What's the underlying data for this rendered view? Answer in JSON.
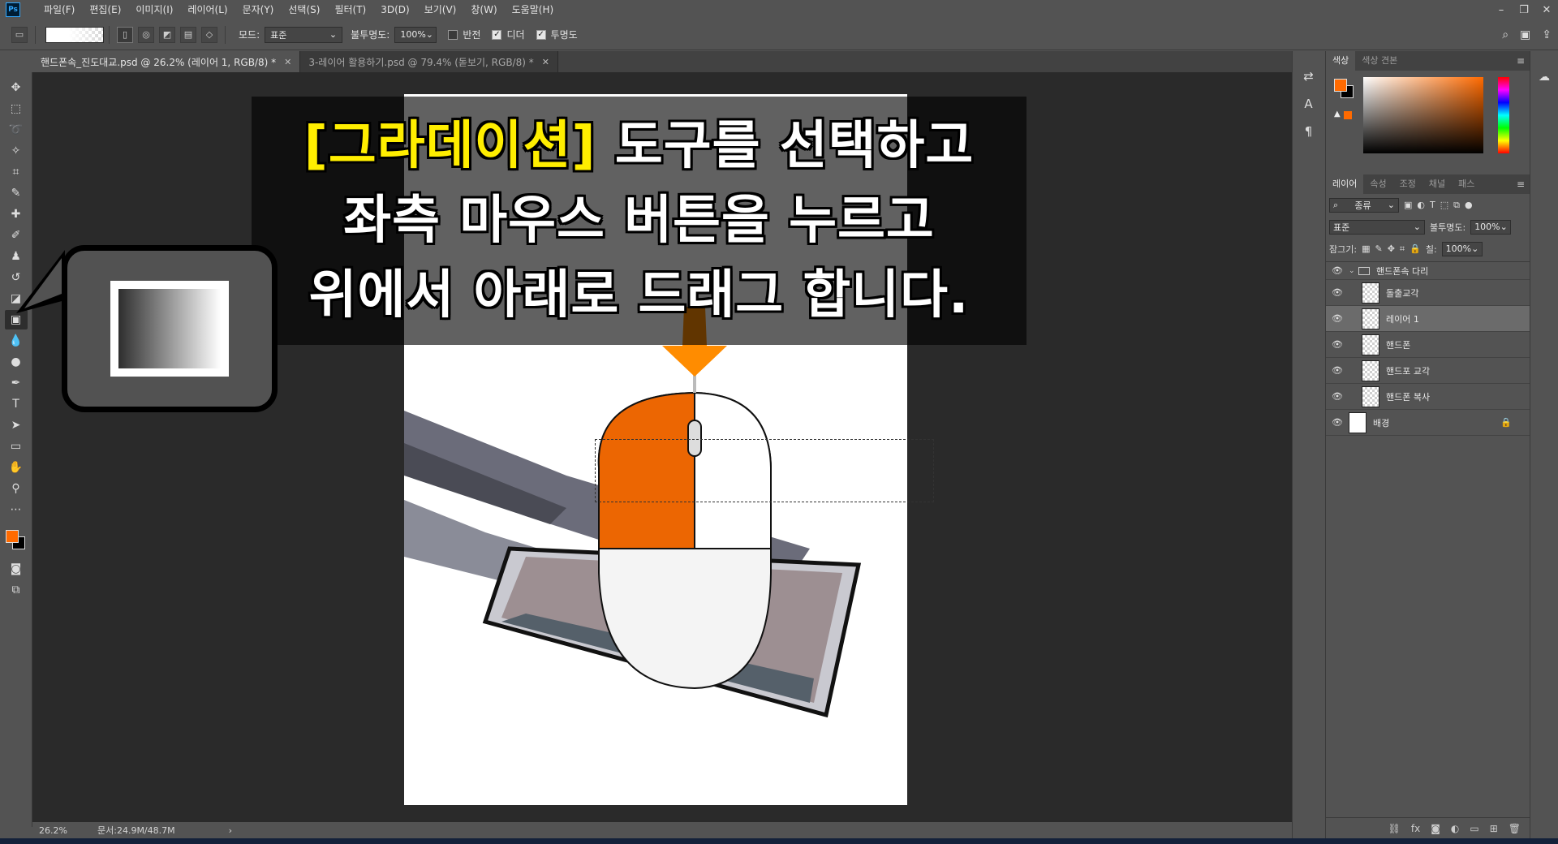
{
  "menu": {
    "items": [
      "파일(F)",
      "편집(E)",
      "이미지(I)",
      "레이어(L)",
      "문자(Y)",
      "선택(S)",
      "필터(T)",
      "3D(D)",
      "보기(V)",
      "창(W)",
      "도움말(H)"
    ]
  },
  "window_controls": [
    "–",
    "❐",
    "✕"
  ],
  "options": {
    "mode_label": "모드:",
    "mode_value": "표준",
    "opacity_label": "불투명도:",
    "opacity_value": "100%",
    "reverse_label": "반전",
    "dither_label": "디더",
    "transparency_label": "투명도",
    "reverse_checked": false,
    "dither_checked": true,
    "transparency_checked": true
  },
  "tabs": [
    {
      "title": "핸드폰속_진도대교.psd @ 26.2% (레이어 1, RGB/8) *",
      "active": true
    },
    {
      "title": "3-레이어 활용하기.psd @ 79.4% (돋보기, RGB/8) *",
      "active": false
    }
  ],
  "caption": {
    "line1_highlight": "[그라데이션]",
    "line1_rest": " 도구를 선택하고",
    "line2": "좌측 마우스 버튼을 누르고",
    "line3": "위에서 아래로 드래그 합니다."
  },
  "status": {
    "zoom": "26.2%",
    "doc": "문서:24.9M/48.7M"
  },
  "color_panel": {
    "tabs": [
      "색상",
      "색상 견본"
    ],
    "foreground": "#ff6a00",
    "background": "#000000"
  },
  "layers_panel": {
    "tabs": [
      "레이어",
      "속성",
      "조정",
      "채널",
      "패스"
    ],
    "filter_label": "종류",
    "blend_mode": "표준",
    "opacity_label": "불투명도:",
    "opacity_value": "100%",
    "lock_label": "잠그기:",
    "fill_label": "칠:",
    "fill_value": "100%",
    "group_name": "핸드폰속 다리",
    "layers": [
      {
        "name": "돌출교각",
        "selected": false
      },
      {
        "name": "레이어 1",
        "selected": true
      },
      {
        "name": "핸드폰",
        "selected": false
      },
      {
        "name": "핸드포 교각",
        "selected": false
      },
      {
        "name": "핸드폰 복사",
        "selected": false
      }
    ],
    "background_layer": "배경"
  },
  "accent_color": "#ff6a00"
}
